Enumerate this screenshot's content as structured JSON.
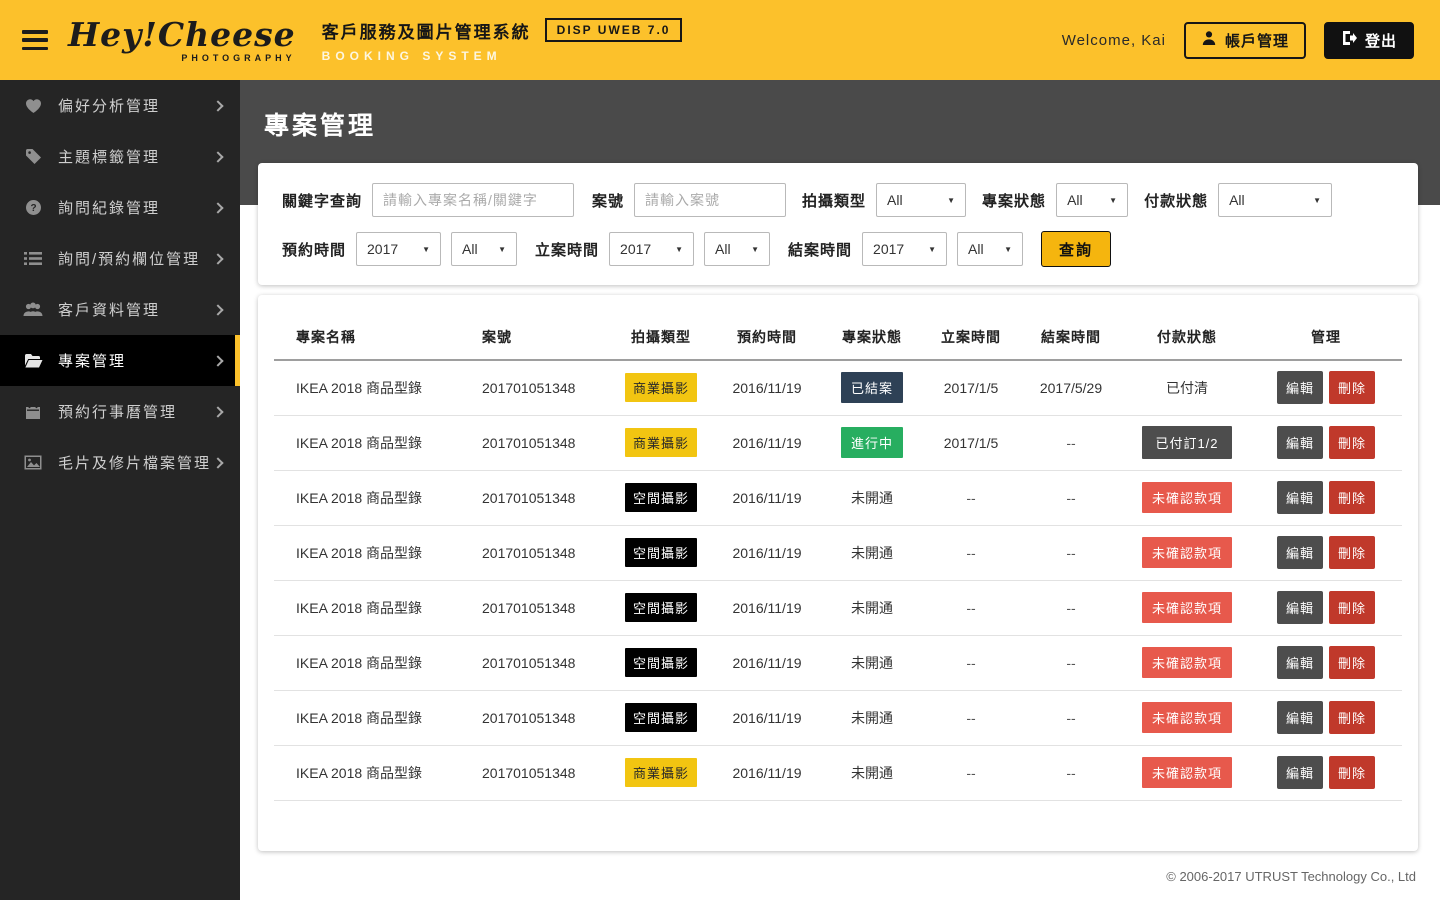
{
  "header": {
    "logo_script": "Hey!Cheese",
    "logo_sub": "PHOTOGRAPHY",
    "title": "客戶服務及圖片管理系統",
    "version_badge": "DISP UWEB 7.0",
    "subtitle": "BOOKING SYSTEM",
    "welcome": "Welcome, Kai",
    "account_button": "帳戶管理",
    "logout_button": "登出"
  },
  "sidebar": {
    "items": [
      {
        "key": "preference",
        "icon": "heart-icon",
        "label": "偏好分析管理",
        "active": false
      },
      {
        "key": "tags",
        "icon": "tag-icon",
        "label": "主題標籤管理",
        "active": false
      },
      {
        "key": "inquiry",
        "icon": "question-icon",
        "label": "詢問紀錄管理",
        "active": false
      },
      {
        "key": "fields",
        "icon": "list-icon",
        "label": "詢問/預約欄位管理",
        "active": false
      },
      {
        "key": "customers",
        "icon": "users-icon",
        "label": "客戶資料管理",
        "active": false
      },
      {
        "key": "projects",
        "icon": "folder-icon",
        "label": "專案管理",
        "active": true
      },
      {
        "key": "calendar",
        "icon": "calendar-icon",
        "label": "預約行事曆管理",
        "active": false
      },
      {
        "key": "files",
        "icon": "image-icon",
        "label": "毛片及修片檔案管理",
        "active": false
      }
    ]
  },
  "page": {
    "title": "專案管理"
  },
  "filters": {
    "keyword_label": "關鍵字查詢",
    "keyword_placeholder": "請輸入專案名稱/關鍵字",
    "case_label": "案號",
    "case_placeholder": "請輸入案號",
    "shoot_type_label": "拍攝類型",
    "shoot_type_value": "All",
    "project_status_label": "專案狀態",
    "project_status_value": "All",
    "payment_status_label": "付款狀態",
    "payment_status_value": "All",
    "booking_time_label": "預約時間",
    "booking_year": "2017",
    "booking_month": "All",
    "open_time_label": "立案時間",
    "open_year": "2017",
    "open_month": "All",
    "close_time_label": "結案時間",
    "close_year": "2017",
    "close_month": "All",
    "search_button": "查詢"
  },
  "table": {
    "headers": [
      "專案名稱",
      "案號",
      "拍攝類型",
      "預約時間",
      "專案狀態",
      "立案時間",
      "結案時間",
      "付款狀態",
      "管理"
    ],
    "edit_label": "編輯",
    "delete_label": "刪除",
    "rows": [
      {
        "name": "IKEA 2018 商品型錄",
        "case_no": "201701051348",
        "shoot_type": {
          "text": "商業攝影",
          "style": "yellow"
        },
        "booking": "2016/11/19",
        "status": {
          "text": "已結案",
          "style": "navy"
        },
        "open": "2017/1/5",
        "close": "2017/5/29",
        "payment": {
          "text": "已付清",
          "style": "plain"
        }
      },
      {
        "name": "IKEA 2018 商品型錄",
        "case_no": "201701051348",
        "shoot_type": {
          "text": "商業攝影",
          "style": "yellow"
        },
        "booking": "2016/11/19",
        "status": {
          "text": "進行中",
          "style": "green"
        },
        "open": "2017/1/5",
        "close": "--",
        "payment": {
          "text": "已付訂1/2",
          "style": "gray"
        }
      },
      {
        "name": "IKEA 2018 商品型錄",
        "case_no": "201701051348",
        "shoot_type": {
          "text": "空間攝影",
          "style": "black"
        },
        "booking": "2016/11/19",
        "status": {
          "text": "未開通",
          "style": "plain"
        },
        "open": "--",
        "close": "--",
        "payment": {
          "text": "未確認款項",
          "style": "red"
        }
      },
      {
        "name": "IKEA 2018 商品型錄",
        "case_no": "201701051348",
        "shoot_type": {
          "text": "空間攝影",
          "style": "black"
        },
        "booking": "2016/11/19",
        "status": {
          "text": "未開通",
          "style": "plain"
        },
        "open": "--",
        "close": "--",
        "payment": {
          "text": "未確認款項",
          "style": "red"
        }
      },
      {
        "name": "IKEA 2018 商品型錄",
        "case_no": "201701051348",
        "shoot_type": {
          "text": "空間攝影",
          "style": "black"
        },
        "booking": "2016/11/19",
        "status": {
          "text": "未開通",
          "style": "plain"
        },
        "open": "--",
        "close": "--",
        "payment": {
          "text": "未確認款項",
          "style": "red"
        }
      },
      {
        "name": "IKEA 2018 商品型錄",
        "case_no": "201701051348",
        "shoot_type": {
          "text": "空間攝影",
          "style": "black"
        },
        "booking": "2016/11/19",
        "status": {
          "text": "未開通",
          "style": "plain"
        },
        "open": "--",
        "close": "--",
        "payment": {
          "text": "未確認款項",
          "style": "red"
        }
      },
      {
        "name": "IKEA 2018 商品型錄",
        "case_no": "201701051348",
        "shoot_type": {
          "text": "空間攝影",
          "style": "black"
        },
        "booking": "2016/11/19",
        "status": {
          "text": "未開通",
          "style": "plain"
        },
        "open": "--",
        "close": "--",
        "payment": {
          "text": "未確認款項",
          "style": "red"
        }
      },
      {
        "name": "IKEA 2018 商品型錄",
        "case_no": "201701051348",
        "shoot_type": {
          "text": "商業攝影",
          "style": "yellow"
        },
        "booking": "2016/11/19",
        "status": {
          "text": "未開通",
          "style": "plain"
        },
        "open": "--",
        "close": "--",
        "payment": {
          "text": "未確認款項",
          "style": "red"
        }
      }
    ]
  },
  "footer": {
    "copyright": "© 2006-2017 UTRUST Technology Co., Ltd"
  },
  "colors": {
    "header_yellow": "#FCC12B",
    "sidebar_bg": "#252525",
    "sidebar_active_bg": "#000000",
    "active_accent": "#FCC12B",
    "band_gray": "#4A4A4A",
    "badge_yellow": "#F2C511",
    "badge_black": "#000000",
    "badge_navy": "#2E4156",
    "badge_green": "#27AE60",
    "badge_gray": "#4D4D4D",
    "badge_red": "#E7594C",
    "delete_red": "#C0392B",
    "search_amber": "#F5B50E"
  }
}
